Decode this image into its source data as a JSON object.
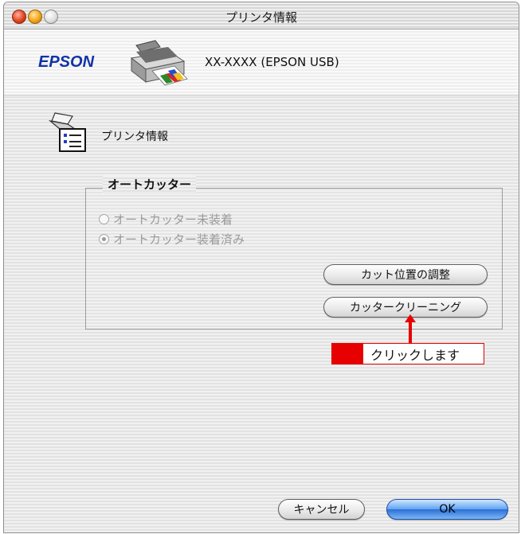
{
  "window": {
    "title": "プリンタ情報"
  },
  "header": {
    "brand": "EPSON",
    "model": "XX-XXXX (EPSON USB)"
  },
  "section": {
    "title": "プリンタ情報"
  },
  "auto_cutter": {
    "group_label": "オートカッター",
    "options": [
      {
        "label": "オートカッター未装着",
        "checked": false,
        "enabled": false
      },
      {
        "label": "オートカッター装着済み",
        "checked": true,
        "enabled": false
      }
    ],
    "adjust_button": "カット位置の調整",
    "clean_button": "カッタークリーニング"
  },
  "annotation": {
    "text": "クリックします",
    "color": "#e60000"
  },
  "footer": {
    "cancel_label": "キャンセル",
    "ok_label": "OK"
  },
  "colors": {
    "brand": "#1133a8",
    "ok_button": "#2d6fd4"
  }
}
